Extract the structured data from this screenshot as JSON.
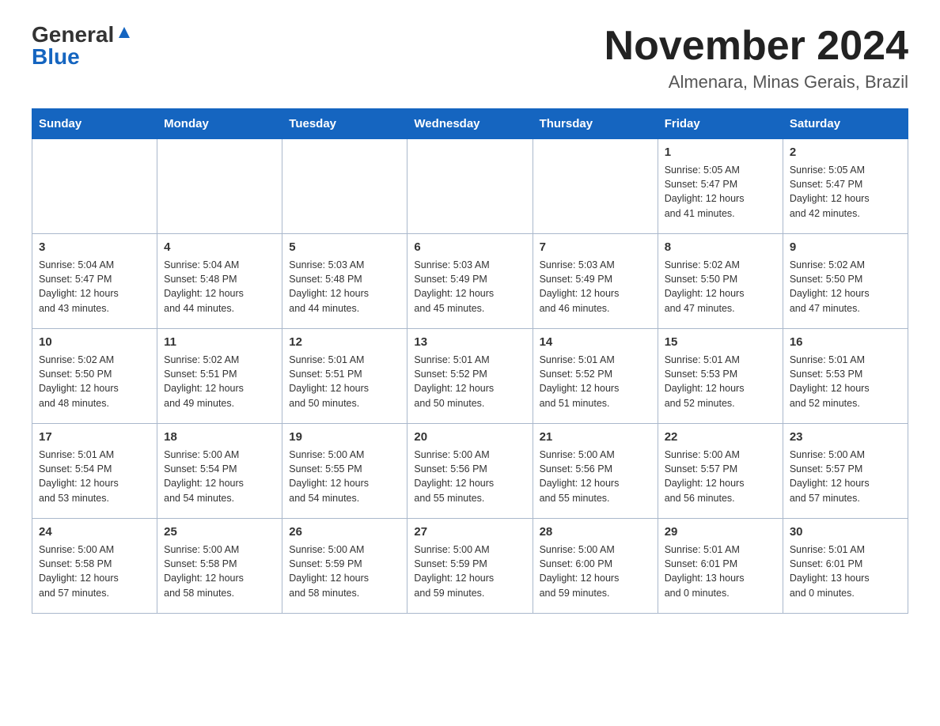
{
  "header": {
    "logo_general": "General",
    "logo_blue": "Blue",
    "month_title": "November 2024",
    "location": "Almenara, Minas Gerais, Brazil"
  },
  "days_of_week": [
    "Sunday",
    "Monday",
    "Tuesday",
    "Wednesday",
    "Thursday",
    "Friday",
    "Saturday"
  ],
  "weeks": [
    {
      "days": [
        {
          "number": "",
          "info": ""
        },
        {
          "number": "",
          "info": ""
        },
        {
          "number": "",
          "info": ""
        },
        {
          "number": "",
          "info": ""
        },
        {
          "number": "",
          "info": ""
        },
        {
          "number": "1",
          "info": "Sunrise: 5:05 AM\nSunset: 5:47 PM\nDaylight: 12 hours\nand 41 minutes."
        },
        {
          "number": "2",
          "info": "Sunrise: 5:05 AM\nSunset: 5:47 PM\nDaylight: 12 hours\nand 42 minutes."
        }
      ]
    },
    {
      "days": [
        {
          "number": "3",
          "info": "Sunrise: 5:04 AM\nSunset: 5:47 PM\nDaylight: 12 hours\nand 43 minutes."
        },
        {
          "number": "4",
          "info": "Sunrise: 5:04 AM\nSunset: 5:48 PM\nDaylight: 12 hours\nand 44 minutes."
        },
        {
          "number": "5",
          "info": "Sunrise: 5:03 AM\nSunset: 5:48 PM\nDaylight: 12 hours\nand 44 minutes."
        },
        {
          "number": "6",
          "info": "Sunrise: 5:03 AM\nSunset: 5:49 PM\nDaylight: 12 hours\nand 45 minutes."
        },
        {
          "number": "7",
          "info": "Sunrise: 5:03 AM\nSunset: 5:49 PM\nDaylight: 12 hours\nand 46 minutes."
        },
        {
          "number": "8",
          "info": "Sunrise: 5:02 AM\nSunset: 5:50 PM\nDaylight: 12 hours\nand 47 minutes."
        },
        {
          "number": "9",
          "info": "Sunrise: 5:02 AM\nSunset: 5:50 PM\nDaylight: 12 hours\nand 47 minutes."
        }
      ]
    },
    {
      "days": [
        {
          "number": "10",
          "info": "Sunrise: 5:02 AM\nSunset: 5:50 PM\nDaylight: 12 hours\nand 48 minutes."
        },
        {
          "number": "11",
          "info": "Sunrise: 5:02 AM\nSunset: 5:51 PM\nDaylight: 12 hours\nand 49 minutes."
        },
        {
          "number": "12",
          "info": "Sunrise: 5:01 AM\nSunset: 5:51 PM\nDaylight: 12 hours\nand 50 minutes."
        },
        {
          "number": "13",
          "info": "Sunrise: 5:01 AM\nSunset: 5:52 PM\nDaylight: 12 hours\nand 50 minutes."
        },
        {
          "number": "14",
          "info": "Sunrise: 5:01 AM\nSunset: 5:52 PM\nDaylight: 12 hours\nand 51 minutes."
        },
        {
          "number": "15",
          "info": "Sunrise: 5:01 AM\nSunset: 5:53 PM\nDaylight: 12 hours\nand 52 minutes."
        },
        {
          "number": "16",
          "info": "Sunrise: 5:01 AM\nSunset: 5:53 PM\nDaylight: 12 hours\nand 52 minutes."
        }
      ]
    },
    {
      "days": [
        {
          "number": "17",
          "info": "Sunrise: 5:01 AM\nSunset: 5:54 PM\nDaylight: 12 hours\nand 53 minutes."
        },
        {
          "number": "18",
          "info": "Sunrise: 5:00 AM\nSunset: 5:54 PM\nDaylight: 12 hours\nand 54 minutes."
        },
        {
          "number": "19",
          "info": "Sunrise: 5:00 AM\nSunset: 5:55 PM\nDaylight: 12 hours\nand 54 minutes."
        },
        {
          "number": "20",
          "info": "Sunrise: 5:00 AM\nSunset: 5:56 PM\nDaylight: 12 hours\nand 55 minutes."
        },
        {
          "number": "21",
          "info": "Sunrise: 5:00 AM\nSunset: 5:56 PM\nDaylight: 12 hours\nand 55 minutes."
        },
        {
          "number": "22",
          "info": "Sunrise: 5:00 AM\nSunset: 5:57 PM\nDaylight: 12 hours\nand 56 minutes."
        },
        {
          "number": "23",
          "info": "Sunrise: 5:00 AM\nSunset: 5:57 PM\nDaylight: 12 hours\nand 57 minutes."
        }
      ]
    },
    {
      "days": [
        {
          "number": "24",
          "info": "Sunrise: 5:00 AM\nSunset: 5:58 PM\nDaylight: 12 hours\nand 57 minutes."
        },
        {
          "number": "25",
          "info": "Sunrise: 5:00 AM\nSunset: 5:58 PM\nDaylight: 12 hours\nand 58 minutes."
        },
        {
          "number": "26",
          "info": "Sunrise: 5:00 AM\nSunset: 5:59 PM\nDaylight: 12 hours\nand 58 minutes."
        },
        {
          "number": "27",
          "info": "Sunrise: 5:00 AM\nSunset: 5:59 PM\nDaylight: 12 hours\nand 59 minutes."
        },
        {
          "number": "28",
          "info": "Sunrise: 5:00 AM\nSunset: 6:00 PM\nDaylight: 12 hours\nand 59 minutes."
        },
        {
          "number": "29",
          "info": "Sunrise: 5:01 AM\nSunset: 6:01 PM\nDaylight: 13 hours\nand 0 minutes."
        },
        {
          "number": "30",
          "info": "Sunrise: 5:01 AM\nSunset: 6:01 PM\nDaylight: 13 hours\nand 0 minutes."
        }
      ]
    }
  ]
}
